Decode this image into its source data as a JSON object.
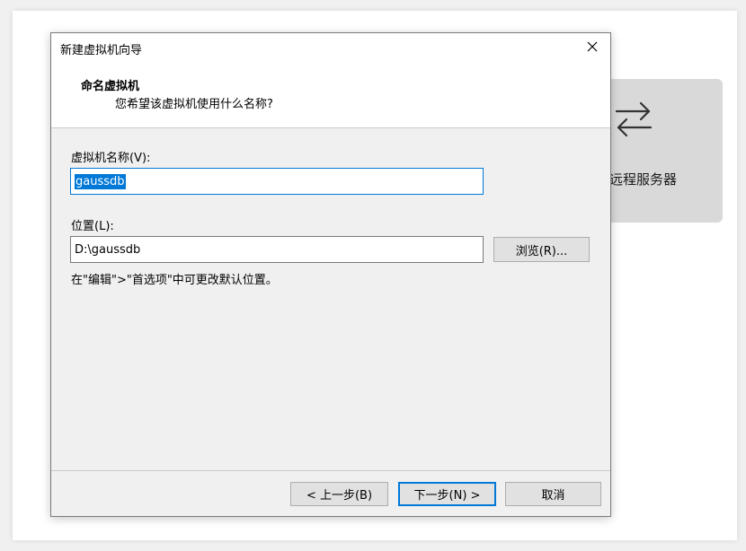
{
  "background": {
    "remote_server_label": "远程服务器",
    "remote_server_icon": "swap-arrows-icon"
  },
  "dialog": {
    "title": "新建虚拟机向导",
    "close_icon": "close-icon",
    "header": {
      "title": "命名虚拟机",
      "subtitle": "您希望该虚拟机使用什么名称?"
    },
    "vm_name": {
      "label": "虚拟机名称(V):",
      "value": "gaussdb"
    },
    "location": {
      "label": "位置(L):",
      "value": "D:\\gaussdb",
      "browse_label": "浏览(R)..."
    },
    "hint": "在\"编辑\">\"首选项\"中可更改默认位置。",
    "buttons": {
      "back": "< 上一步(B)",
      "next": "下一步(N) >",
      "cancel": "取消"
    }
  },
  "colors": {
    "accent": "#0078d7",
    "dialog_bg": "#f0f0f0",
    "card_bg": "#d9d9d9"
  }
}
